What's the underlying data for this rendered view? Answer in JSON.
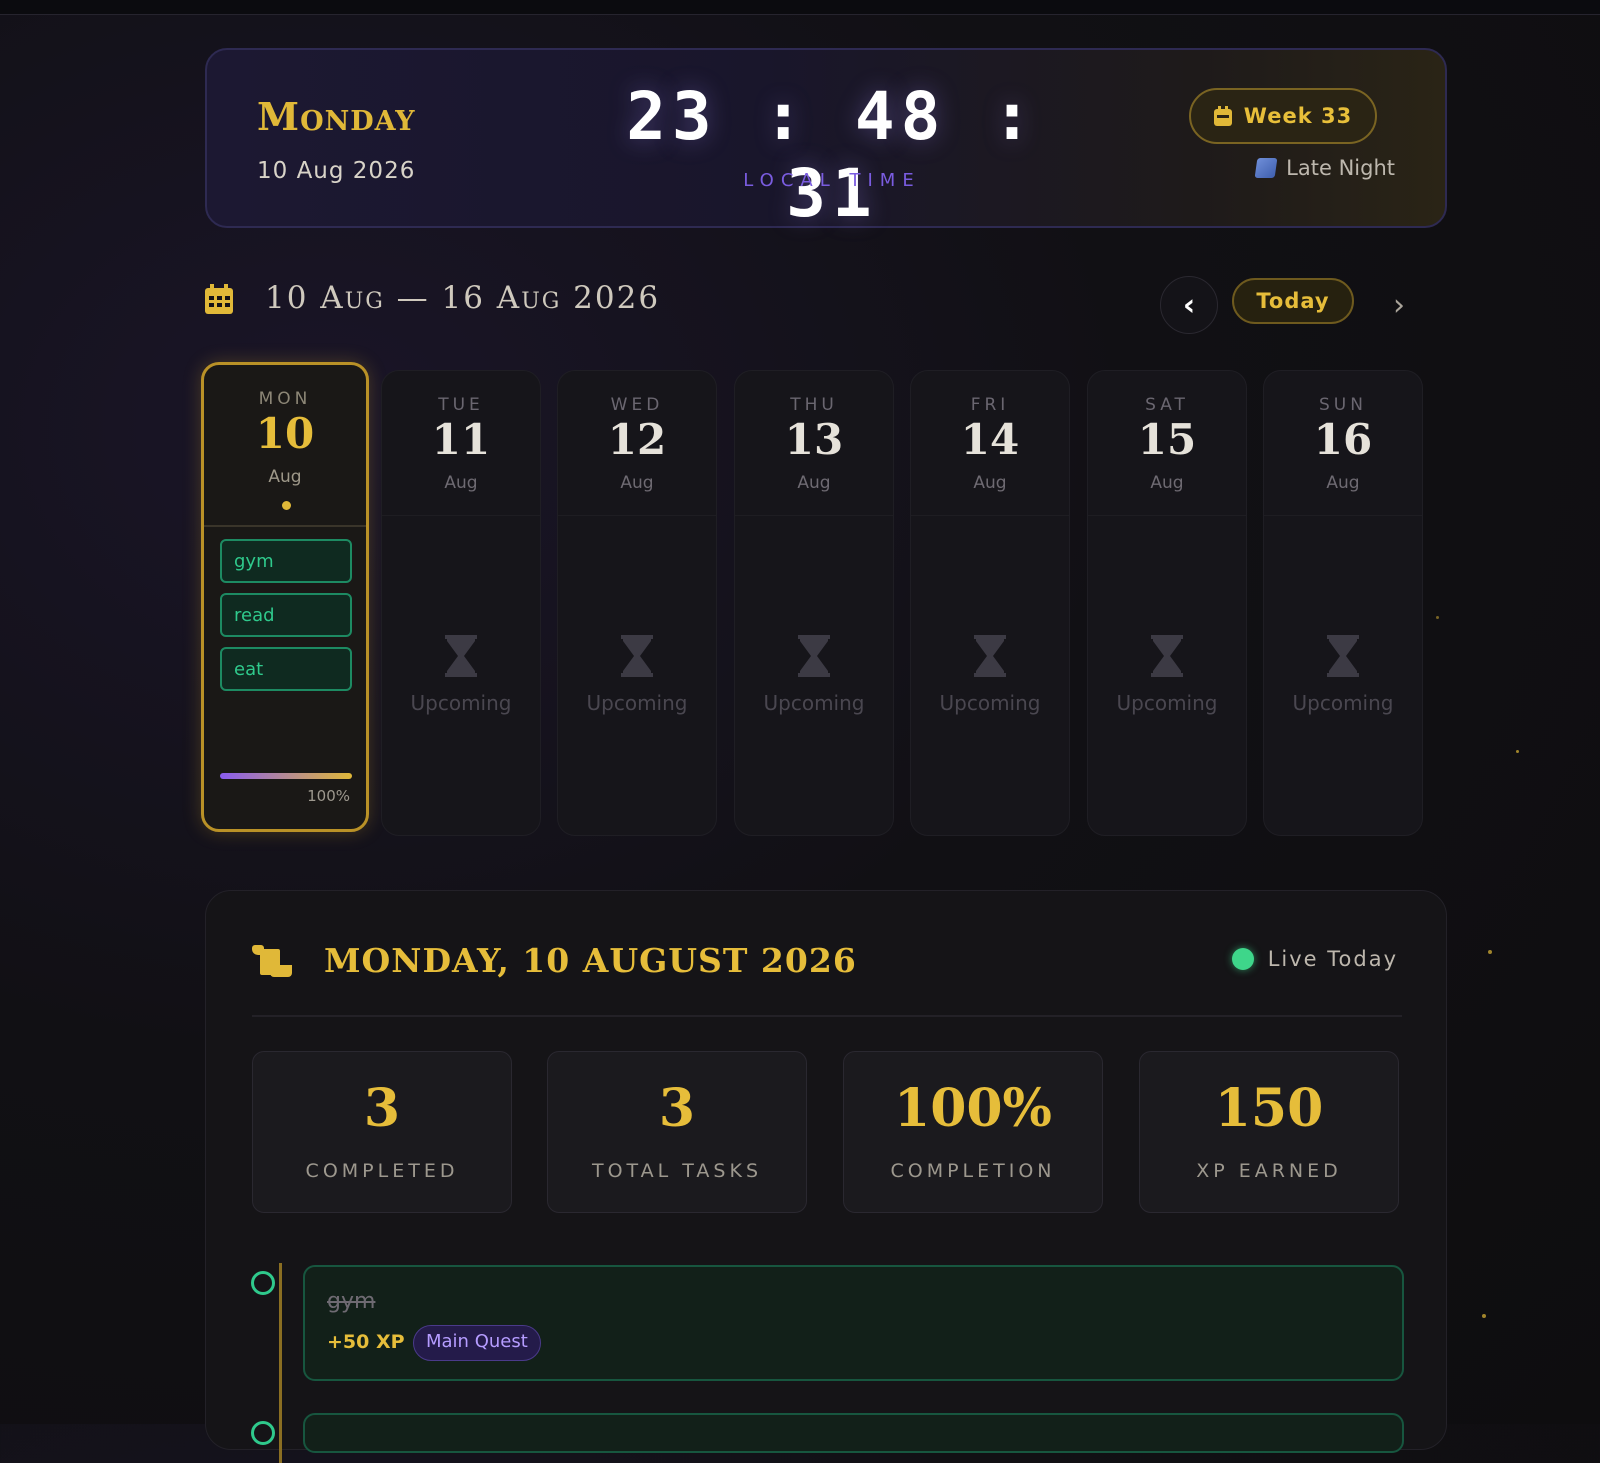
{
  "header": {
    "day_name": "Monday",
    "date": "10 Aug 2026",
    "time": "23:48:31",
    "time_label": "LOCAL TIME",
    "week_label": "Week 33",
    "phase_label": "Late Night"
  },
  "week_nav": {
    "range": "10 Aug — 16 Aug 2026",
    "prev_icon": "chevron-left-icon",
    "today_label": "Today",
    "next_icon": "chevron-right-icon"
  },
  "days": [
    {
      "dow": "MON",
      "num": "10",
      "month": "Aug",
      "active": true,
      "tasks": [
        "gym",
        "read",
        "eat"
      ],
      "progress_pct": 100,
      "progress_label": "100%"
    },
    {
      "dow": "TUE",
      "num": "11",
      "month": "Aug",
      "status": "Upcoming"
    },
    {
      "dow": "WED",
      "num": "12",
      "month": "Aug",
      "status": "Upcoming"
    },
    {
      "dow": "THU",
      "num": "13",
      "month": "Aug",
      "status": "Upcoming"
    },
    {
      "dow": "FRI",
      "num": "14",
      "month": "Aug",
      "status": "Upcoming"
    },
    {
      "dow": "SAT",
      "num": "15",
      "month": "Aug",
      "status": "Upcoming"
    },
    {
      "dow": "SUN",
      "num": "16",
      "month": "Aug",
      "status": "Upcoming"
    }
  ],
  "detail": {
    "title": "MONDAY, 10 AUGUST 2026",
    "live_label": "Live Today",
    "stats": [
      {
        "value": "3",
        "label": "COMPLETED"
      },
      {
        "value": "3",
        "label": "TOTAL TASKS"
      },
      {
        "value": "100%",
        "label": "COMPLETION"
      },
      {
        "value": "150",
        "label": "XP EARNED"
      }
    ],
    "tasks": [
      {
        "name": "gym",
        "xp": "+50 XP",
        "tag": "Main Quest",
        "done": true
      }
    ]
  },
  "colors": {
    "accent_gold": "#e0b838",
    "accent_purple": "#7a5ce0",
    "task_green": "#2fc98c"
  }
}
